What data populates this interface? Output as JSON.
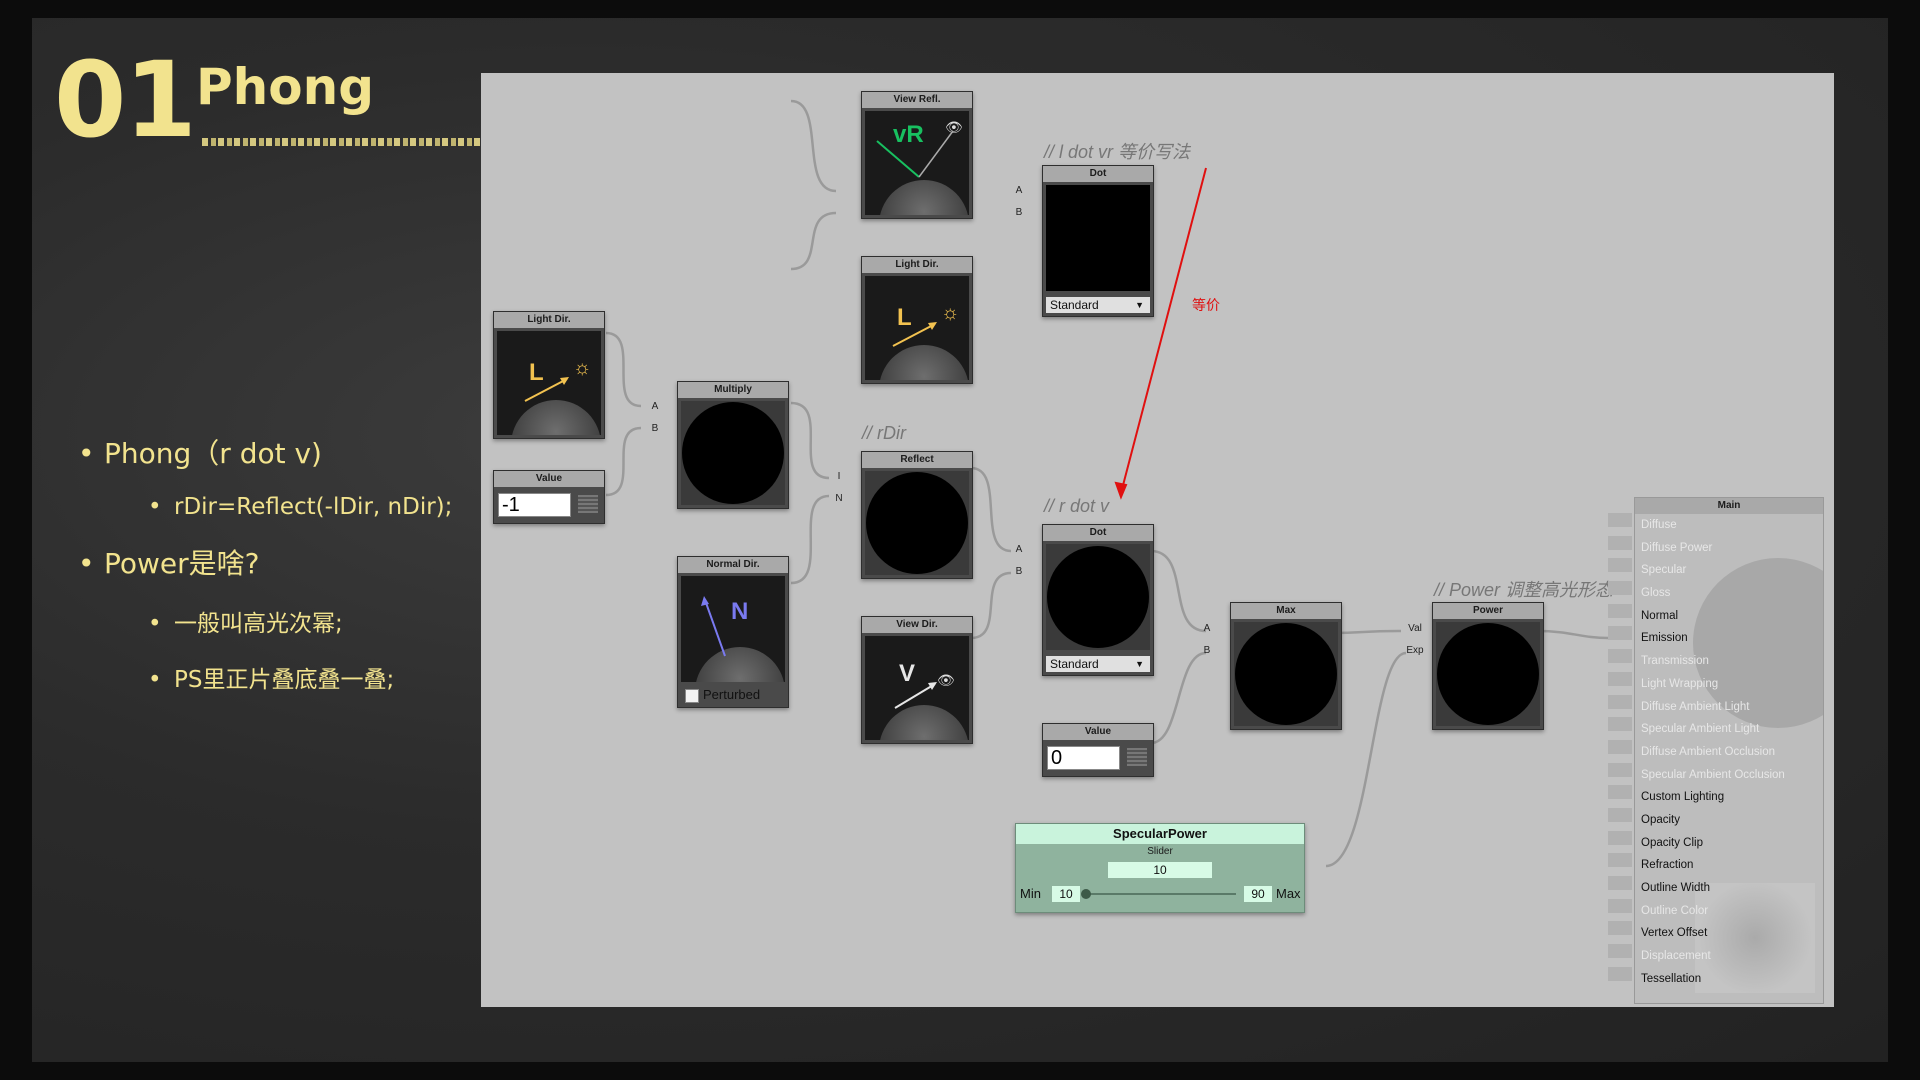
{
  "slide": {
    "number": "01",
    "title": "Phong",
    "bullets": [
      {
        "level": 1,
        "text": "Phong（r dot v)"
      },
      {
        "level": 2,
        "text": "rDir=Reflect(-lDir, nDir);"
      },
      {
        "level": 1,
        "text": "Power是啥?"
      },
      {
        "level": 2,
        "text": "一般叫高光次幂;"
      },
      {
        "level": 2,
        "text": "PS里正片叠底叠一叠;"
      }
    ],
    "colors": {
      "accent": "#f2e38e",
      "board": "#2b2b2b"
    }
  },
  "graph": {
    "nodes": {
      "light_dir_1": {
        "title": "Light Dir.",
        "glyph": "L"
      },
      "value_1": {
        "title": "Value",
        "value": "-1"
      },
      "multiply": {
        "title": "Multiply",
        "pins": [
          "A",
          "B"
        ]
      },
      "normal_dir": {
        "title": "Normal Dir.",
        "glyph": "N",
        "checkbox_label": "Perturbed"
      },
      "view_refl": {
        "title": "View Refl.",
        "glyph": "vR"
      },
      "light_dir_2": {
        "title": "Light Dir.",
        "glyph": "L"
      },
      "reflect": {
        "title": "Reflect",
        "pins": [
          "I",
          "N"
        ]
      },
      "view_dir": {
        "title": "View Dir.",
        "glyph": "V"
      },
      "dot_1": {
        "title": "Dot",
        "pins": [
          "A",
          "B"
        ],
        "mode": "Standard"
      },
      "dot_2": {
        "title": "Dot",
        "pins": [
          "A",
          "B"
        ],
        "mode": "Standard"
      },
      "value_2": {
        "title": "Value",
        "value": "0"
      },
      "max": {
        "title": "Max",
        "pins": [
          "A",
          "B"
        ]
      },
      "power": {
        "title": "Power",
        "pins": [
          "Val",
          "Exp"
        ]
      }
    },
    "comments": {
      "ldot": "//  l dot vr 等价写法",
      "rdir": "// rDir",
      "rdotv": "// r dot v",
      "power": "//  Power 调整高光形态"
    },
    "annotation": {
      "text": "等价",
      "color": "#e01010"
    },
    "specular_power": {
      "title": "SpecularPower",
      "subtitle": "Slider",
      "value": "10",
      "min_label": "Min",
      "min": "10",
      "max_label": "Max",
      "max": "90",
      "level": 0.0
    },
    "main_panel": {
      "title": "Main",
      "items": [
        {
          "label": "Diffuse",
          "active": false
        },
        {
          "label": "Diffuse Power",
          "active": false
        },
        {
          "label": "Specular",
          "active": false
        },
        {
          "label": "Gloss",
          "active": false
        },
        {
          "label": "Normal",
          "active": true
        },
        {
          "label": "Emission",
          "active": true
        },
        {
          "label": "Transmission",
          "active": false
        },
        {
          "label": "Light Wrapping",
          "active": false
        },
        {
          "label": "Diffuse Ambient Light",
          "active": false
        },
        {
          "label": "Specular Ambient Light",
          "active": false
        },
        {
          "label": "Diffuse Ambient Occlusion",
          "active": false
        },
        {
          "label": "Specular Ambient Occlusion",
          "active": false
        },
        {
          "label": "Custom Lighting",
          "active": true
        },
        {
          "label": "Opacity",
          "active": true
        },
        {
          "label": "Opacity Clip",
          "active": true
        },
        {
          "label": "Refraction",
          "active": true
        },
        {
          "label": "Outline Width",
          "active": true
        },
        {
          "label": "Outline Color",
          "active": false
        },
        {
          "label": "Vertex Offset",
          "active": true
        },
        {
          "label": "Displacement",
          "active": false
        },
        {
          "label": "Tessellation",
          "active": true
        }
      ]
    }
  }
}
